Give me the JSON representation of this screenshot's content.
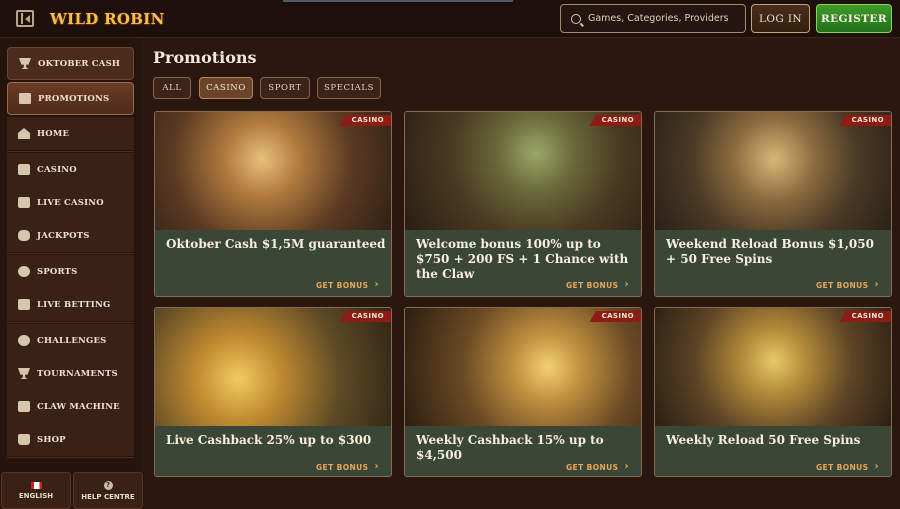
{
  "header": {
    "logo_text": "WILD ROBIN",
    "search_placeholder": "Games, Categories, Providers",
    "login_label": "LOG IN",
    "register_label": "REGISTER"
  },
  "sidebar": {
    "items": [
      {
        "label": "OKTOBER CASH",
        "icon": "beer-mug-icon"
      },
      {
        "label": "PROMOTIONS",
        "icon": "gift-icon"
      },
      {
        "label": "HOME",
        "icon": "home-icon"
      },
      {
        "label": "CASINO",
        "icon": "slot-machine-icon"
      },
      {
        "label": "LIVE CASINO",
        "icon": "cards-icon"
      },
      {
        "label": "JACKPOTS",
        "icon": "clover-icon"
      },
      {
        "label": "SPORTS",
        "icon": "ball-icon"
      },
      {
        "label": "LIVE BETTING",
        "icon": "live-tv-icon"
      },
      {
        "label": "CHALLENGES",
        "icon": "target-icon"
      },
      {
        "label": "TOURNAMENTS",
        "icon": "trophy-icon"
      },
      {
        "label": "CLAW MACHINE",
        "icon": "claw-icon"
      },
      {
        "label": "SHOP",
        "icon": "shopping-bag-icon"
      }
    ],
    "language_label": "ENGLISH",
    "help_label": "HELP CENTRE",
    "help_icon_glyph": "?"
  },
  "main": {
    "title": "Promotions",
    "tabs": [
      {
        "label": "ALL"
      },
      {
        "label": "CASINO"
      },
      {
        "label": "SPORT"
      },
      {
        "label": "SPECIALS"
      }
    ],
    "cards": [
      {
        "badge": "CASINO",
        "title": "Oktober Cash $1,5M guaranteed",
        "cta": "GET BONUS"
      },
      {
        "badge": "CASINO",
        "title": "Welcome bonus 100% up to $750 + 200 FS + 1 Chance with the Claw",
        "cta": "GET BONUS"
      },
      {
        "badge": "CASINO",
        "title": "Weekend Reload Bonus $1,050 + 50 Free Spins",
        "cta": "GET BONUS"
      },
      {
        "badge": "CASINO",
        "title": "Live Cashback 25% up to $300",
        "cta": "GET BONUS"
      },
      {
        "badge": "CASINO",
        "title": "Weekly Cashback 15% up to $4,500",
        "cta": "GET BONUS"
      },
      {
        "badge": "CASINO",
        "title": "Weekly Reload 50 Free Spins",
        "cta": "GET BONUS"
      }
    ]
  },
  "colors": {
    "accent_green": "#3e9a2a",
    "badge_red": "#8c1c14",
    "cta_orange": "#e9a65a"
  }
}
